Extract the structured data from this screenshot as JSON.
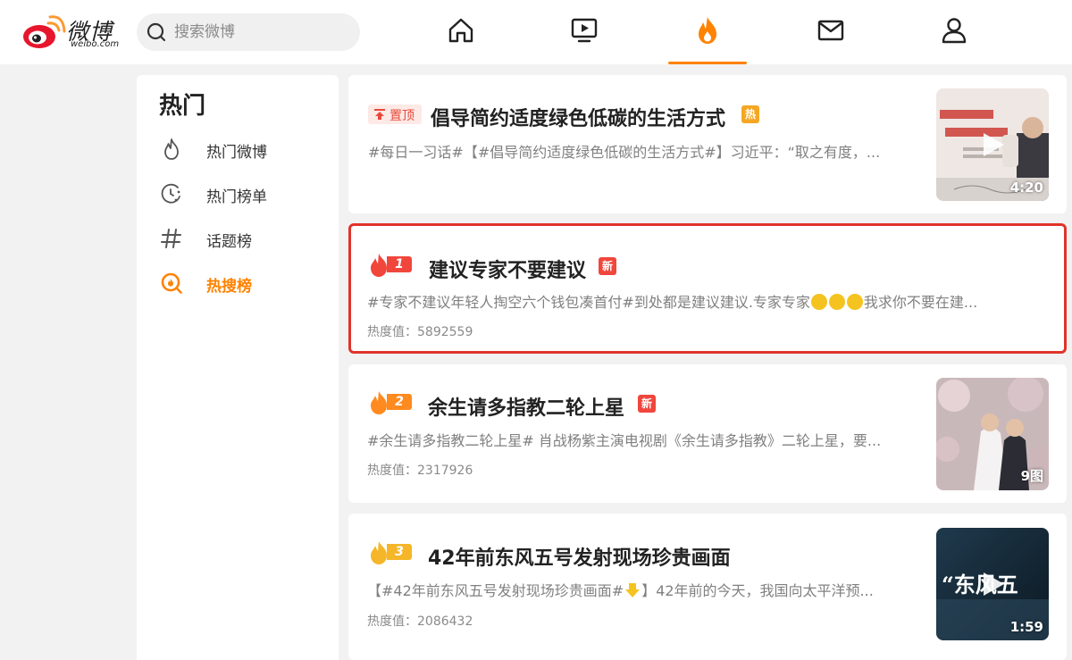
{
  "header": {
    "logo_text": "微博",
    "logo_sub": "weibo.com",
    "search_placeholder": "搜索微博",
    "nav": [
      "home-icon",
      "video-icon",
      "hot-flame-icon",
      "mail-icon",
      "profile-icon"
    ],
    "accent": "#ff8200"
  },
  "sidebar": {
    "title": "热门",
    "items": [
      {
        "label": "热门微博",
        "icon": "flame-outline-icon"
      },
      {
        "label": "热门榜单",
        "icon": "clock-list-icon"
      },
      {
        "label": "话题榜",
        "icon": "hashtag-icon"
      },
      {
        "label": "热搜榜",
        "icon": "hot-search-icon",
        "active": true
      }
    ]
  },
  "feed": [
    {
      "badge": "置顶",
      "title": "倡导简约适度绿色低碳的生活方式",
      "tag": "热",
      "tag_color": "#f5a623",
      "desc": "#每日一习话#【#倡导简约适度绿色低碳的生活方式#】习近平：“取之有度，...",
      "thumb_label": "4:20"
    },
    {
      "rank": "1",
      "rank_color": "#f0463c",
      "title": "建议专家不要建议",
      "tag": "新",
      "tag_color": "#f0463c",
      "desc_before": "#专家不建议年轻人掏空六个钱包凑首付#到处都是建议建议.专家专家",
      "desc_after": "我求你不要在建...",
      "heat": "热度值：5892559"
    },
    {
      "rank": "2",
      "rank_color": "#ff8a1f",
      "title": "余生请多指教二轮上星",
      "tag": "新",
      "tag_color": "#f0463c",
      "desc": "#余生请多指教二轮上星# 肖战杨紫主演电视剧《余生请多指教》二轮上星，要...",
      "heat": "热度值：2317926",
      "thumb_label": "9图"
    },
    {
      "rank": "3",
      "rank_color": "#f5b629",
      "title": "42年前东风五号发射现场珍贵画面",
      "desc_before": "【#42年前东风五号发射现场珍贵画面#",
      "desc_after": "】42年前的今天，我国向太平洋预...",
      "heat": "热度值：2086432",
      "thumb_label": "1:59",
      "thumb_text": "“东风五"
    }
  ]
}
